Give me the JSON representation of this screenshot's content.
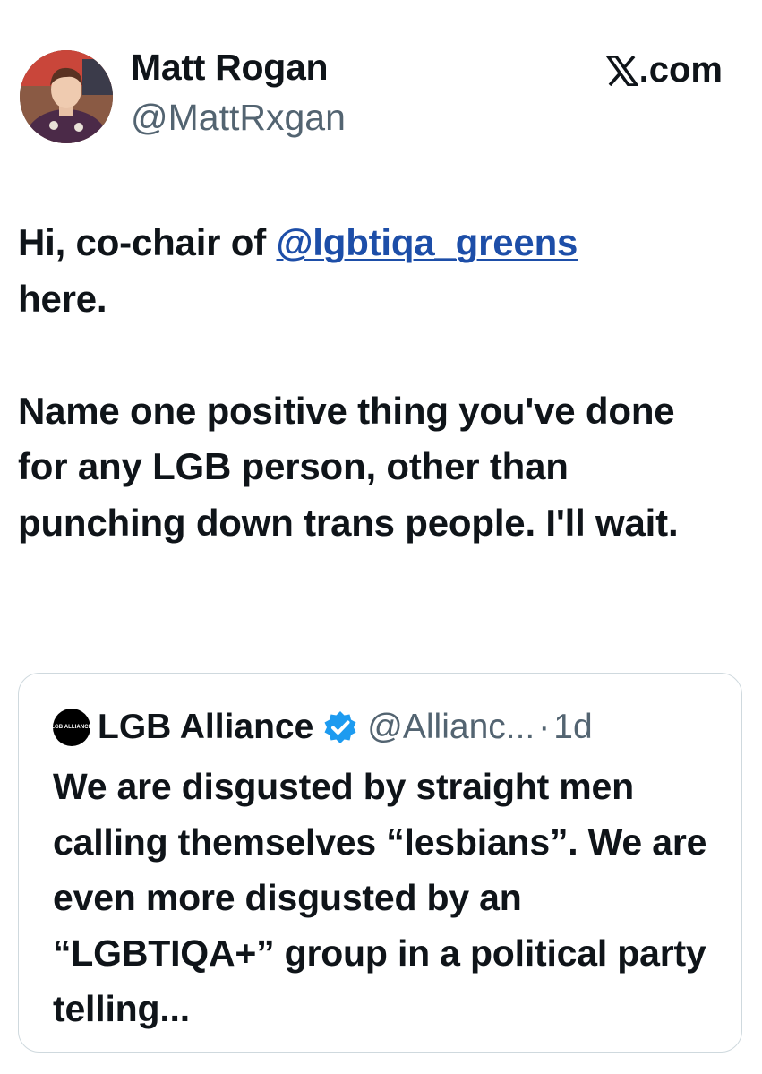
{
  "post": {
    "author_name": "Matt Rogan",
    "author_handle": "@MattRxgan",
    "brand": ".com",
    "text_1_prefix": "Hi, co-chair of ",
    "text_1_mention": "@lgbtiqa_greens",
    "text_1_suffix": "here.",
    "text_2": "Name one positive thing you've done for any LGB person, other than punching down trans people. I'll wait."
  },
  "quoted": {
    "logo_text": "LGB ALLIANCE",
    "name": "LGB Alliance",
    "handle": "@Allianc...",
    "separator": "·",
    "time": "1d",
    "text": "We are disgusted by straight men calling themselves “lesbians”. We are even more disgusted by an “LGBTIQA+” group in a political party telling..."
  },
  "colors": {
    "mention": "#1d4ea8",
    "verified_badge": "#1d9bf0",
    "secondary_text": "#536471",
    "border": "#cfd9de"
  },
  "icons": {
    "brand": "x-logo-icon",
    "verified": "verified-badge-icon"
  }
}
